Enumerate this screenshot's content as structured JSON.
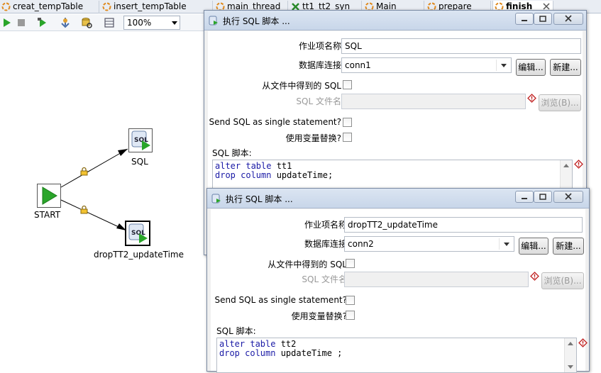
{
  "tabs": [
    {
      "label": "creat_tempTable",
      "icon": "job-icon"
    },
    {
      "label": "insert_tempTable",
      "icon": "job-icon"
    },
    {
      "label": "main_thread",
      "icon": "job-icon"
    },
    {
      "label": "tt1_tt2_syn",
      "icon": "transform-icon"
    },
    {
      "label": "Main",
      "icon": "job-icon"
    },
    {
      "label": "prepare",
      "icon": "job-icon"
    },
    {
      "label": "finish",
      "icon": "job-icon",
      "active": true
    }
  ],
  "toolbar": {
    "zoom": "100%"
  },
  "canvas": {
    "nodes": {
      "start": "START",
      "sql": "SQL",
      "drop": "dropTT2_updateTime"
    }
  },
  "dialog1": {
    "title": "执行 SQL 脚本 ...",
    "job_name_label": "作业项名称",
    "job_name_value": "SQL",
    "db_conn_label": "数据库连接",
    "db_conn_value": "conn1",
    "edit_button": "编辑...",
    "new_button": "新建...",
    "from_file_label": "从文件中得到的 SQL",
    "sql_file_label": "SQL 文件名",
    "browse_button": "浏览(B)...",
    "single_stmt_label": "Send SQL as single statement?",
    "var_sub_label": "使用变量替换?",
    "script_label": "SQL 脚本:",
    "script": {
      "line1_kw": "alter table",
      "line1_rest": " tt1",
      "line2_kw": "drop column",
      "line2_rest": " updateTime;"
    }
  },
  "dialog2": {
    "title": "执行 SQL 脚本 ...",
    "job_name_label": "作业项名称",
    "job_name_value": "dropTT2_updateTime",
    "db_conn_label": "数据库连接",
    "db_conn_value": "conn2",
    "edit_button": "编辑...",
    "new_button": "新建...",
    "from_file_label": "从文件中得到的 SQL",
    "sql_file_label": "SQL 文件名",
    "browse_button": "浏览(B)...",
    "single_stmt_label": "Send SQL as single statement?",
    "var_sub_label": "使用变量替换?",
    "script_label": "SQL 脚本:",
    "script": {
      "line1_kw": "alter table",
      "line1_rest": " tt2",
      "line2_kw": "drop column",
      "line2_rest": " updateTime ;"
    }
  },
  "colors": {
    "keyword": "#1a1aa6",
    "run_green": "#2aa52a",
    "titlebar": "#c8d6e9"
  }
}
